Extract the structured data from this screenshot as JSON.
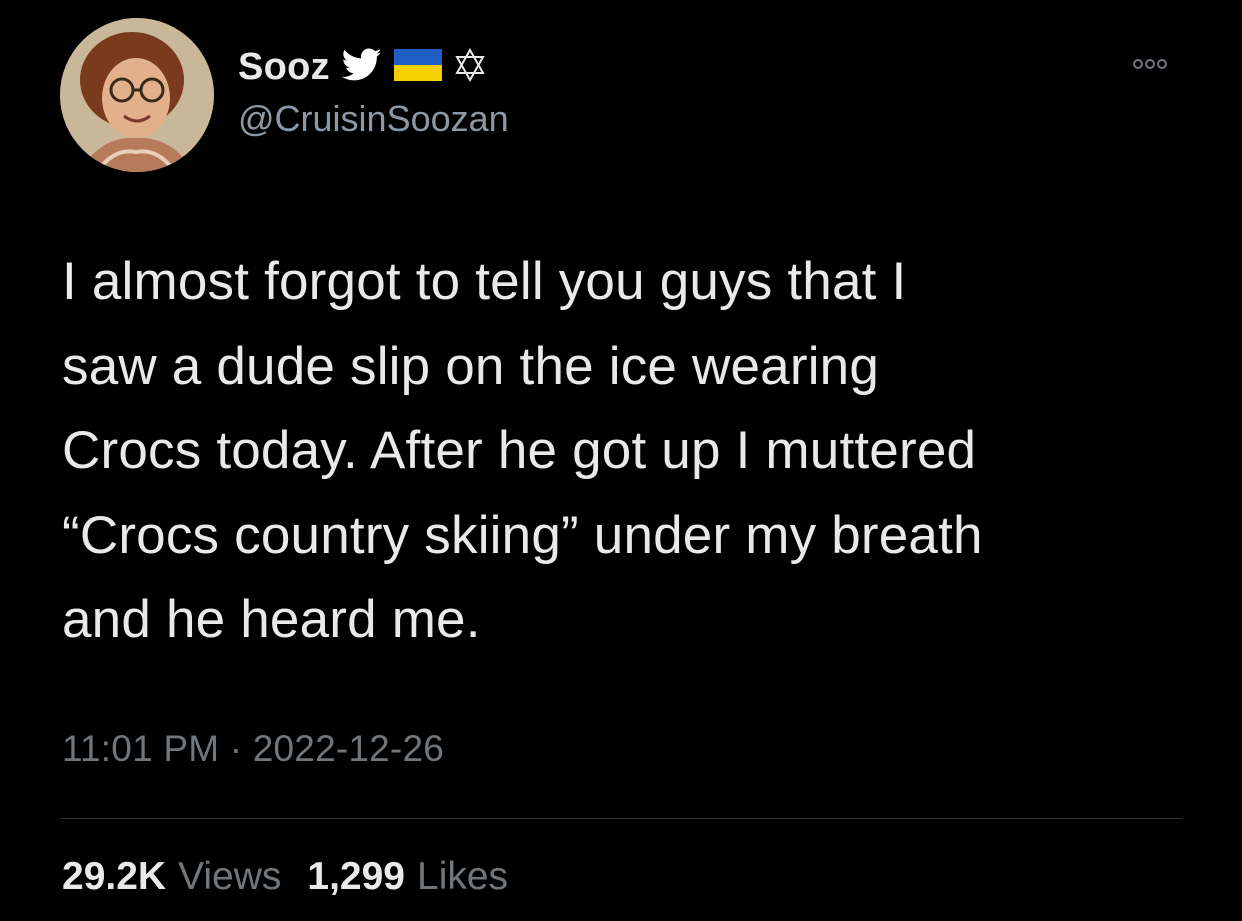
{
  "user": {
    "display_name": "Sooz",
    "handle": "@CruisinSoozan",
    "badges": [
      "twitter-bird-icon",
      "ukraine-flag-icon",
      "star-of-david-icon"
    ]
  },
  "tweet": {
    "text": "I almost forgot to tell you guys that I\nsaw a dude slip on the ice wearing\nCrocs today. After he got up I muttered\n“Crocs country skiing” under my breath\nand he heard me.",
    "time": "11:01 PM",
    "separator": "·",
    "date": "2022-12-26"
  },
  "stats": {
    "views_count": "29.2K",
    "views_label": "Views",
    "likes_count": "1,299",
    "likes_label": "Likes"
  },
  "colors": {
    "background": "#000000",
    "primary_text": "#e7e9ea",
    "secondary_text": "#71767b",
    "twitter_blue": "#1d9bf0",
    "flag_blue": "#1f5fc4",
    "flag_yellow": "#f5d000"
  }
}
